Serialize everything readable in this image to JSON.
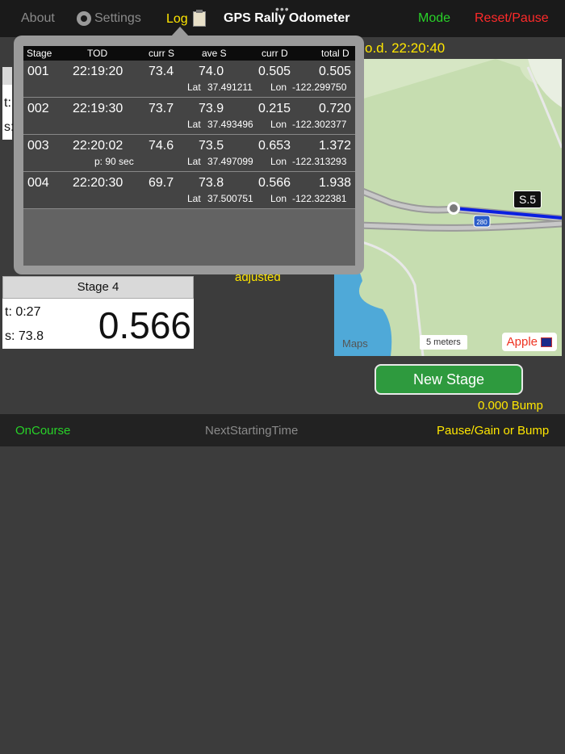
{
  "nav": {
    "about": "About",
    "settings": "Settings",
    "log": "Log",
    "title": "GPS Rally Odometer",
    "mode": "Mode",
    "reset": "Reset/Pause",
    "dots": "•••"
  },
  "tod_text": "o.d. 22:20:40",
  "log": {
    "headers": [
      "Stage",
      "TOD",
      "curr S",
      "ave S",
      "curr D",
      "total D"
    ],
    "rows": [
      {
        "stage": "001",
        "tod": "22:19:20",
        "curr_s": "73.4",
        "ave_s": "74.0",
        "curr_d": "0.505",
        "total_d": "0.505",
        "note": "",
        "lat_label": "Lat",
        "lat": "37.491211",
        "lon_label": "Lon",
        "lon": "-122.299750"
      },
      {
        "stage": "002",
        "tod": "22:19:30",
        "curr_s": "73.7",
        "ave_s": "73.9",
        "curr_d": "0.215",
        "total_d": "0.720",
        "note": "",
        "lat_label": "Lat",
        "lat": "37.493496",
        "lon_label": "Lon",
        "lon": "-122.302377"
      },
      {
        "stage": "003",
        "tod": "22:20:02",
        "curr_s": "74.6",
        "ave_s": "73.5",
        "curr_d": "0.653",
        "total_d": "1.372",
        "note": "p: 90 sec",
        "lat_label": "Lat",
        "lat": "37.497099",
        "lon_label": "Lon",
        "lon": "-122.313293"
      },
      {
        "stage": "004",
        "tod": "22:20:30",
        "curr_s": "69.7",
        "ave_s": "73.8",
        "curr_d": "0.566",
        "total_d": "1.938",
        "note": "",
        "lat_label": "Lat",
        "lat": "37.500751",
        "lon_label": "Lon",
        "lon": "-122.322381"
      }
    ]
  },
  "partial_panel": {
    "t": "t:",
    "s": "s:"
  },
  "stage_panel": {
    "header": "Stage 4",
    "t": "t: 0:27",
    "s": "s: 73.8",
    "distance": "0.566"
  },
  "adjusted": "adjusted",
  "map": {
    "maps_logo": "Maps",
    "scale": "5 meters",
    "attribution": "Apple",
    "stage_flag": "S.5",
    "highway": "280"
  },
  "new_stage": "New Stage",
  "bump": "0.000 Bump",
  "toolbar": {
    "oncourse": "OnCourse",
    "next": "NextStartingTime",
    "pause": "Pause/Gain or Bump"
  },
  "colors": {
    "yellow": "#ffe600",
    "green": "#28d228",
    "red": "#ff2a2a",
    "button_green": "#2e9a3e",
    "route_blue": "#0a1fe0"
  }
}
